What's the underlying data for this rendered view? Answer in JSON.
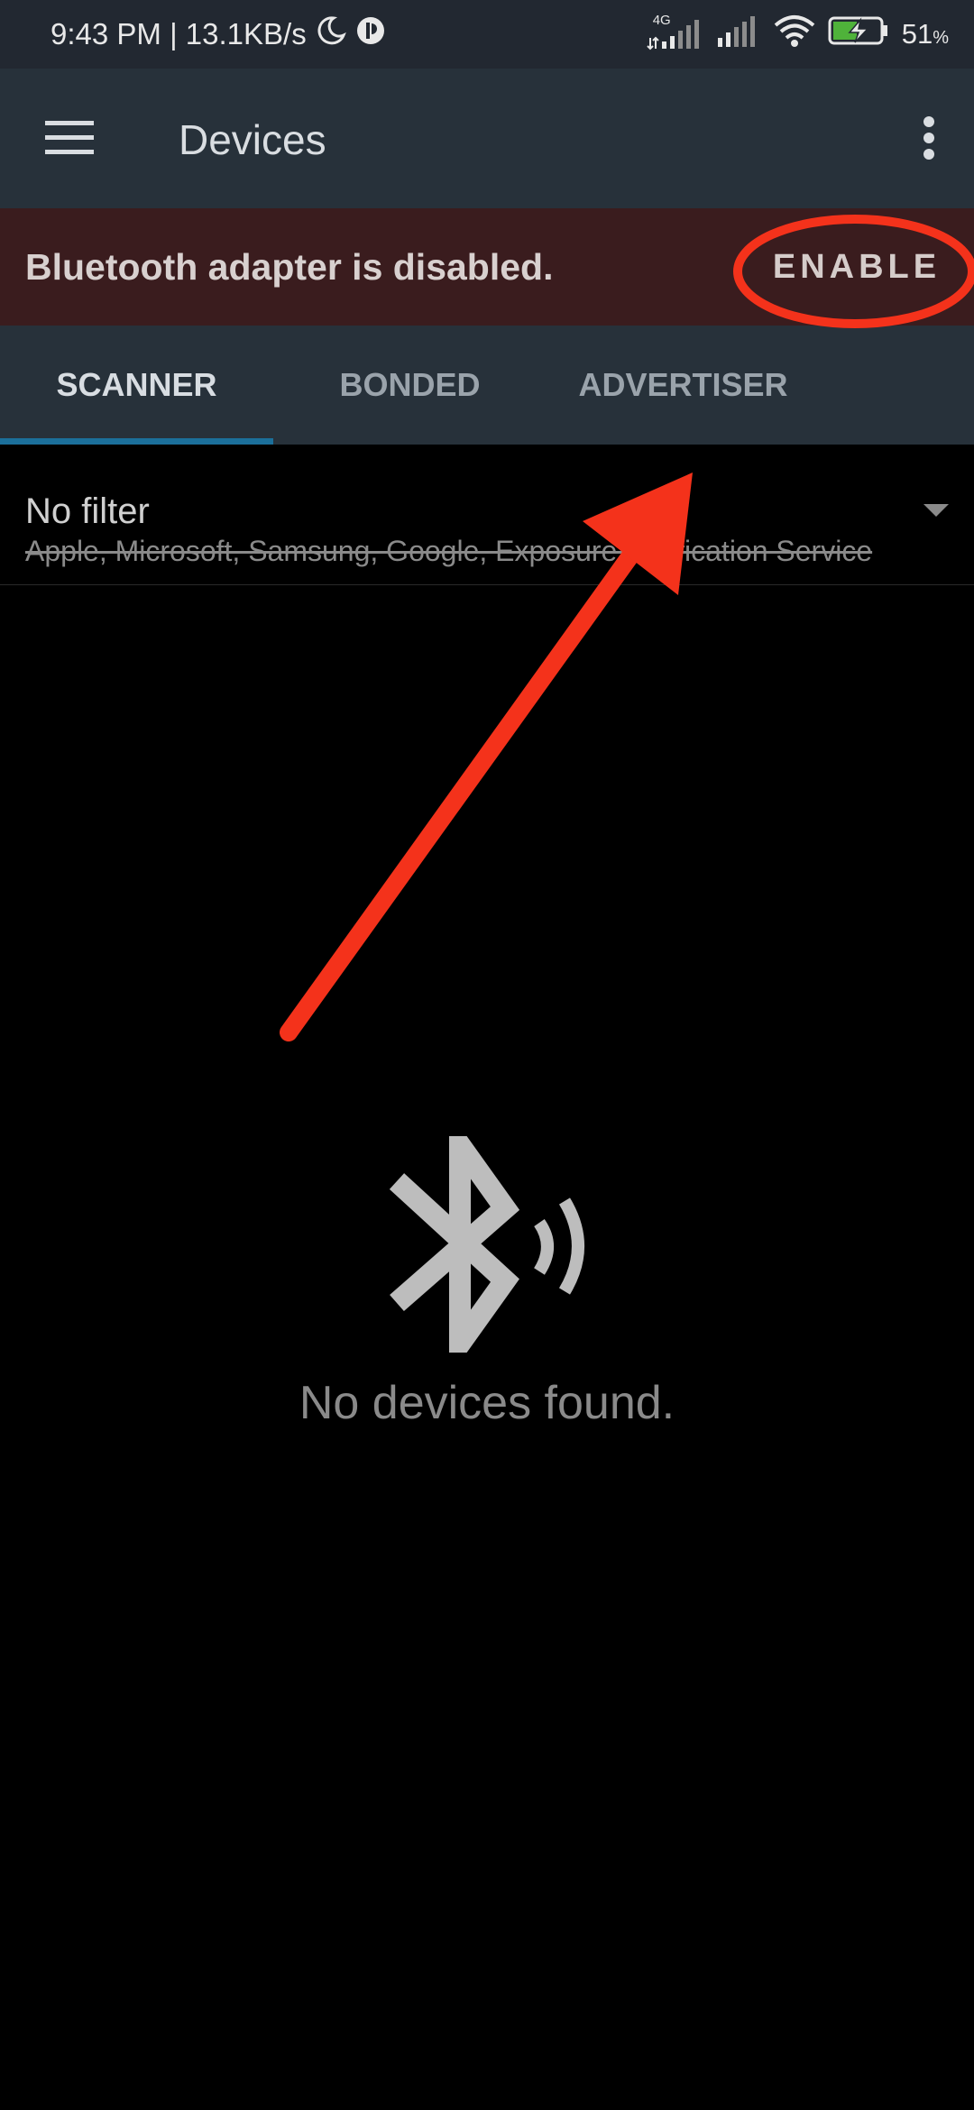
{
  "status_bar": {
    "time_speed": "9:43 PM | 13.1KB/s",
    "network_label": "4G",
    "battery_percent": "51",
    "battery_unit": "%",
    "icons": [
      "moon-icon",
      "app-notification-icon",
      "signal-4g-icon",
      "signal-icon",
      "wifi-icon",
      "battery-charging-icon"
    ]
  },
  "appbar": {
    "title": "Devices",
    "icons": [
      "menu-icon",
      "more-vert-icon"
    ]
  },
  "banner": {
    "message": "Bluetooth adapter is disabled.",
    "action": "ENABLE"
  },
  "tabs": [
    {
      "label": "SCANNER",
      "active": true
    },
    {
      "label": "BONDED",
      "active": false
    },
    {
      "label": "ADVERTISER",
      "active": false
    }
  ],
  "filter": {
    "title": "No filter",
    "subtitle": "Apple, Microsoft, Samsung, Google, Exposure Notification Service"
  },
  "empty_state": {
    "message": "No devices found.",
    "icon": "bluetooth-searching-icon"
  },
  "colors": {
    "annotation": "#f4321b",
    "tab_indicator": "#1b6f9a",
    "banner_bg": "#3a1c1e",
    "appbar_bg": "#27313a"
  }
}
